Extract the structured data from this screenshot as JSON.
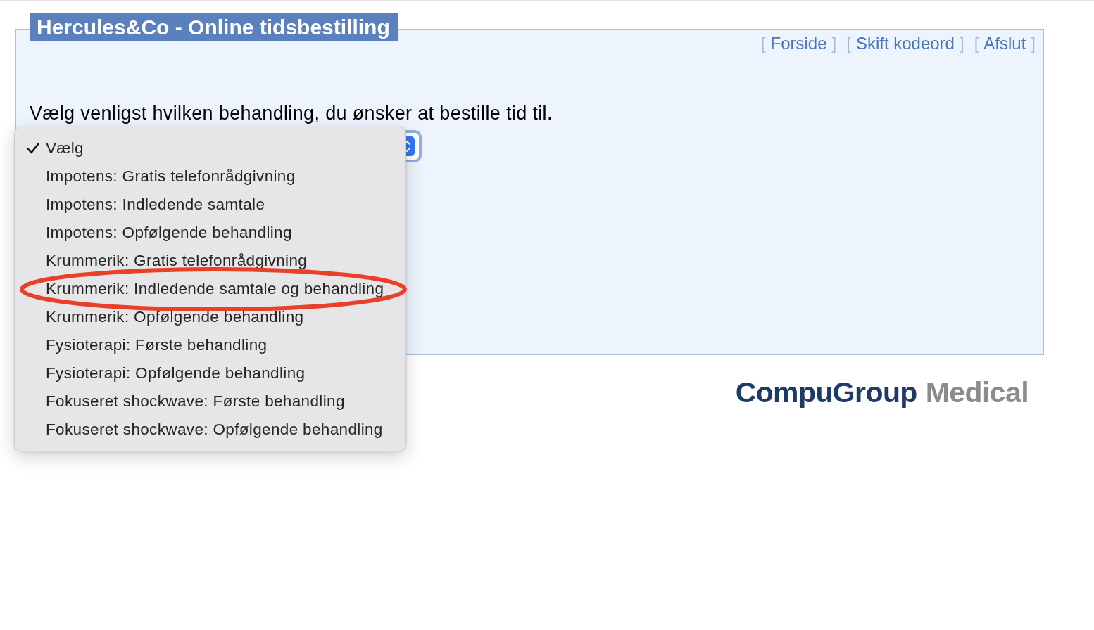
{
  "header": {
    "title": "Hercules&Co - Online tidsbestilling"
  },
  "nav_links": [
    {
      "open": "[",
      "label": "Forside",
      "close": "]"
    },
    {
      "open": "[",
      "label": "Skift kodeord",
      "close": "]"
    },
    {
      "open": "[",
      "label": "Afslut",
      "close": "]"
    }
  ],
  "prompt": "Vælg venligst hvilken behandling, du ønsker at bestille tid til.",
  "treatment_select": {
    "expanded": true,
    "options": [
      {
        "label": "Vælg",
        "selected": true,
        "circled": false
      },
      {
        "label": "Impotens: Gratis telefonrådgivning",
        "selected": false,
        "circled": false
      },
      {
        "label": "Impotens: Indledende samtale",
        "selected": false,
        "circled": false
      },
      {
        "label": "Impotens: Opfølgende behandling",
        "selected": false,
        "circled": false
      },
      {
        "label": "Krummerik: Gratis telefonrådgivning",
        "selected": false,
        "circled": false
      },
      {
        "label": "Krummerik: Indledende samtale og behandling",
        "selected": false,
        "circled": true
      },
      {
        "label": "Krummerik: Opfølgende behandling",
        "selected": false,
        "circled": false
      },
      {
        "label": "Fysioterapi: Første behandling",
        "selected": false,
        "circled": false
      },
      {
        "label": "Fysioterapi: Opfølgende behandling",
        "selected": false,
        "circled": false
      },
      {
        "label": "Fokuseret shockwave: Første behandling",
        "selected": false,
        "circled": false
      },
      {
        "label": "Fokuseret shockwave: Opfølgende behandling",
        "selected": false,
        "circled": false
      }
    ]
  },
  "footer_logo": {
    "primary": "CompuGroup",
    "secondary": "Medical"
  }
}
